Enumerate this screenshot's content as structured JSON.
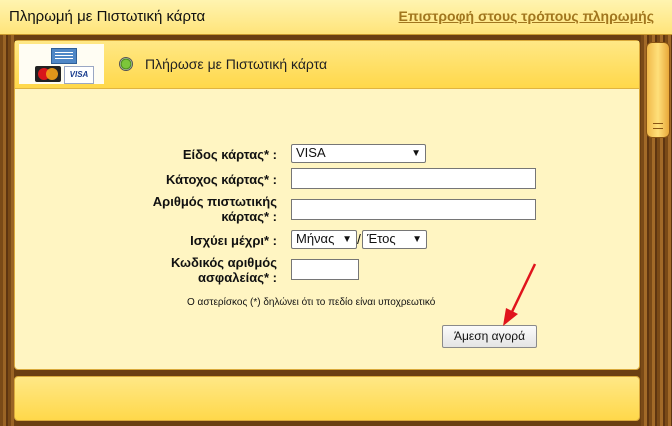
{
  "header": {
    "title": "Πληρωμή με Πιστωτική κάρτα",
    "back_link": "Επιστροφή στους τρόπους πληρωμής"
  },
  "payment_method": {
    "label": "Πλήρωσε με Πιστωτική κάρτα",
    "selected": true,
    "logos": [
      "amex-logo",
      "mastercard-logo",
      "visa-logo"
    ],
    "visa_logo_text": "VISA"
  },
  "form": {
    "card_type_label": "Είδος κάρτας* :",
    "card_type_value": "VISA",
    "holder_label": "Κάτοχος κάρτας* :",
    "holder_value": "",
    "number_label_line1": "Αριθμός πιστωτικής",
    "number_label_line2": "κάρτας* :",
    "number_value": "",
    "expiry_label": "Ισχύει μέχρι* :",
    "expiry_month": "Μήνας",
    "expiry_year": "Έτος",
    "expiry_separator": "/",
    "cvv_label_line1": "Κωδικός αριθμός",
    "cvv_label_line2": "ασφαλείας* :",
    "cvv_value": "",
    "required_note": "Ο αστερίσκος (*) δηλώνει ότι το πεδίο είναι υποχρεωτικό",
    "submit_label": "Άμεση αγορά"
  },
  "colors": {
    "accent_gold": "#ffd84a",
    "link": "#a1761e",
    "annotation_arrow": "#e0141c"
  }
}
